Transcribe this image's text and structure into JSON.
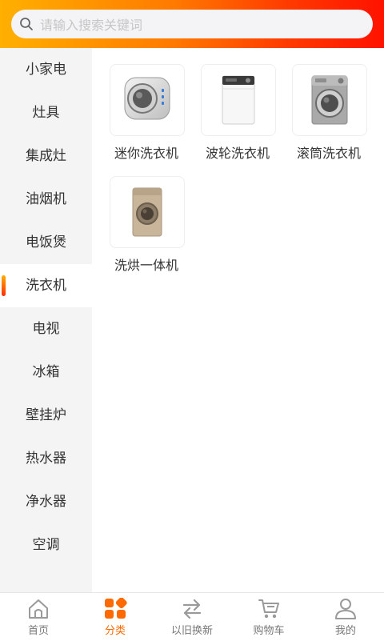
{
  "search": {
    "placeholder": "请输入搜索关键词",
    "value": ""
  },
  "sidebar": {
    "active_index": 5,
    "items": [
      {
        "label": "小家电"
      },
      {
        "label": "灶具"
      },
      {
        "label": "集成灶"
      },
      {
        "label": "油烟机"
      },
      {
        "label": "电饭煲"
      },
      {
        "label": "洗衣机"
      },
      {
        "label": "电视"
      },
      {
        "label": "冰箱"
      },
      {
        "label": "壁挂炉"
      },
      {
        "label": "热水器"
      },
      {
        "label": "净水器"
      },
      {
        "label": "空调"
      }
    ]
  },
  "products": [
    {
      "label": "迷你洗衣机",
      "icon": "mini-washer-icon"
    },
    {
      "label": "波轮洗衣机",
      "icon": "top-load-washer-icon"
    },
    {
      "label": "滚筒洗衣机",
      "icon": "front-load-washer-icon"
    },
    {
      "label": "洗烘一体机",
      "icon": "washer-dryer-icon"
    }
  ],
  "tabbar": {
    "active_index": 1,
    "accent": "#ff6a00",
    "items": [
      {
        "label": "首页",
        "icon": "home-icon"
      },
      {
        "label": "分类",
        "icon": "category-icon"
      },
      {
        "label": "以旧换新",
        "icon": "exchange-icon"
      },
      {
        "label": "购物车",
        "icon": "cart-icon"
      },
      {
        "label": "我的",
        "icon": "user-icon"
      }
    ]
  }
}
